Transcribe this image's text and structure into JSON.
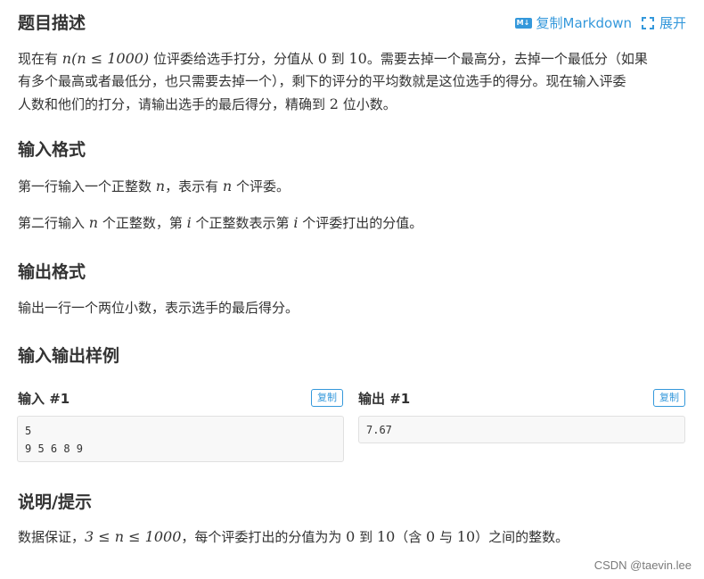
{
  "header": {
    "title": "题目描述",
    "copy_markdown": "复制Markdown",
    "expand": "展开",
    "md_badge": "M↓"
  },
  "description": {
    "line1_prefix": "现在有 ",
    "line1_math": "n(n ≤ 1000)",
    "line1_mid": " 位评委给选手打分，分值从 ",
    "line1_zero": "0",
    "line1_to": " 到 ",
    "line1_ten": "10",
    "line1_suffix": "。需要去掉一个最高分，去掉一个最低分（如果",
    "line2": "有多个最高或者最低分，也只需要去掉一个），剩下的评分的平均数就是这位选手的得分。现在输入评委",
    "line3_prefix": "人数和他们的打分，请输出选手的最后得分，精确到 ",
    "line3_num": "2",
    "line3_suffix": " 位小数。"
  },
  "input_format": {
    "heading": "输入格式",
    "p1_prefix": "第一行输入一个正整数 ",
    "p1_n": "n",
    "p1_mid": "，表示有 ",
    "p1_n2": "n",
    "p1_suffix": " 个评委。",
    "p2_prefix": "第二行输入 ",
    "p2_n": "n",
    "p2_mid1": " 个正整数，第 ",
    "p2_i": "i",
    "p2_mid2": " 个正整数表示第 ",
    "p2_i2": "i",
    "p2_suffix": " 个评委打出的分值。"
  },
  "output_format": {
    "heading": "输出格式",
    "p1": "输出一行一个两位小数，表示选手的最后得分。"
  },
  "samples": {
    "heading": "输入输出样例",
    "input_label": "输入 #1",
    "output_label": "输出 #1",
    "copy_label": "复制",
    "input_line1": "5",
    "input_line2": "9 5 6 8 9",
    "output_line1": "7.67"
  },
  "hint": {
    "heading": "说明/提示",
    "prefix": "数据保证，",
    "math": "3 ≤ n ≤ 1000",
    "mid1": "，每个评委打出的分值为为 ",
    "zero": "0",
    "to": " 到 ",
    "ten": "10",
    "paren_open": "（含 ",
    "zero2": "0",
    "and": " 与 ",
    "ten2": "10",
    "paren_close": "）之间的整数。"
  },
  "watermark": "CSDN @taevin.lee",
  "colors": {
    "accent": "#3498db",
    "text": "#333333",
    "code_bg": "#f8f8f8"
  }
}
